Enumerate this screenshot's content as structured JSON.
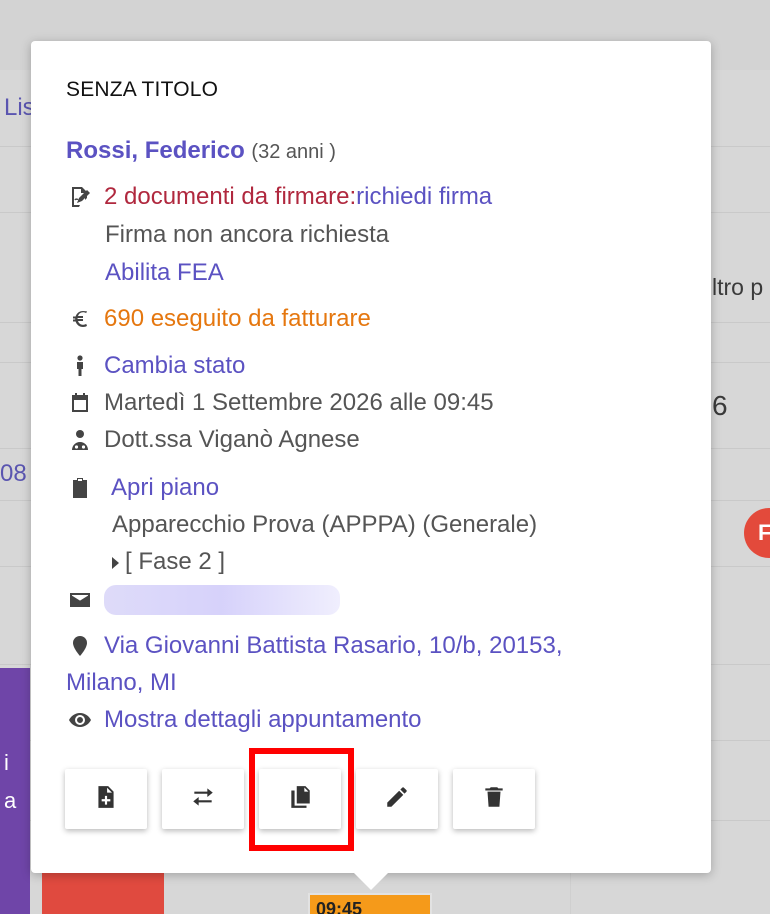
{
  "background": {
    "link_fragment_left": "Lis",
    "text_fragment_right": "ltro p",
    "number_fragment_right": "6",
    "number_fragment_left": "08",
    "circle_letter": "F",
    "purple_text": [
      "i",
      "a"
    ],
    "orange_event_text": "09:45"
  },
  "popup": {
    "title": "SENZA TITOLO",
    "patient": {
      "name": "Rossi, Federico",
      "age": "(32 anni )"
    },
    "documents": {
      "icon": "sign-document-icon",
      "alert": "2 documenti da firmare: ",
      "request_link": "richiedi firma",
      "status": "Firma non ancora richiesta",
      "enable_fea": "Abilita FEA"
    },
    "billing": {
      "icon": "euro-icon",
      "text": "690 eseguito da fatturare"
    },
    "state": {
      "icon": "person-icon",
      "label": "Cambia stato"
    },
    "date": {
      "icon": "calendar-icon",
      "text": "Martedì 1 Settembre 2026 alle 09:45"
    },
    "doctor": {
      "icon": "doctor-icon",
      "text": "Dott.ssa Viganò Agnese"
    },
    "plan": {
      "icon": "clipboard-icon",
      "open_label": "Apri piano",
      "device": "Apparecchio Prova (APPPA) (Generale)",
      "phase": "[ Fase 2 ]"
    },
    "email": {
      "icon": "envelope-icon"
    },
    "address": {
      "icon": "map-pin-icon",
      "line1": "Via Giovanni Battista Rasario, 10/b, 20153,",
      "line2": "Milano, MI"
    },
    "details": {
      "icon": "eye-icon",
      "label": "Mostra dettagli appuntamento"
    },
    "actions": [
      {
        "name": "new-document-button",
        "icon": "file-plus-icon"
      },
      {
        "name": "swap-button",
        "icon": "swap-arrows-icon"
      },
      {
        "name": "copy-button",
        "icon": "copy-icon"
      },
      {
        "name": "edit-button",
        "icon": "pencil-icon"
      },
      {
        "name": "delete-button",
        "icon": "trash-icon"
      }
    ]
  },
  "colors": {
    "link": "#5b52c2",
    "alert_red": "#b0283e",
    "billing_orange": "#e5770f",
    "highlight": "#ff0000"
  }
}
